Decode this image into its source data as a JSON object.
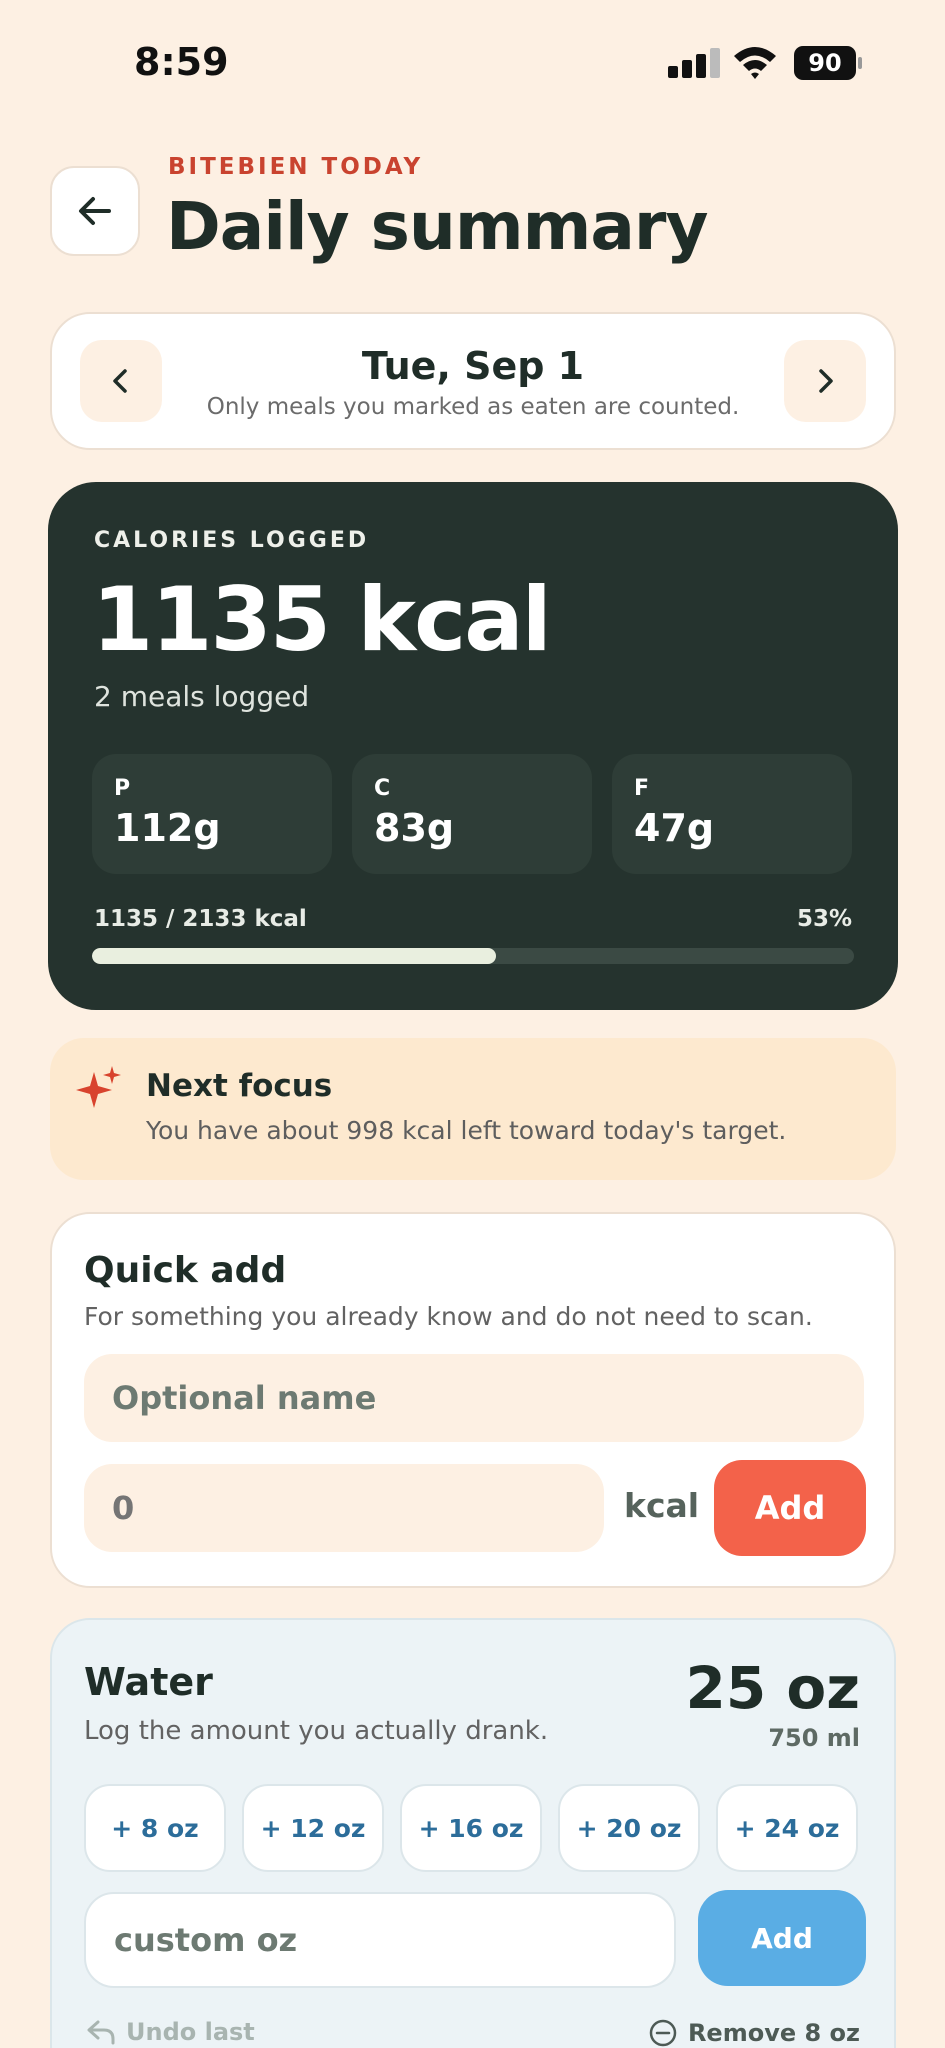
{
  "status_bar": {
    "time": "8:59",
    "battery": "90"
  },
  "header": {
    "eyebrow": "BITEBIEN TODAY",
    "title": "Daily summary"
  },
  "date_card": {
    "date": "Tue, Sep 1",
    "subtitle": "Only meals you marked as eaten are counted."
  },
  "calories": {
    "eyebrow": "CALORIES LOGGED",
    "value": "1135 kcal",
    "meals": "2 meals logged",
    "macros": [
      {
        "label": "P",
        "value": "112g"
      },
      {
        "label": "C",
        "value": "83g"
      },
      {
        "label": "F",
        "value": "47g"
      }
    ],
    "progress_text": "1135 / 2133 kcal",
    "progress_pct": "53%",
    "progress_fraction": 0.53
  },
  "focus": {
    "title": "Next focus",
    "text": "You have about 998 kcal left toward today's target."
  },
  "quick_add": {
    "title": "Quick add",
    "subtitle": "For something you already know and do not need to scan.",
    "name_placeholder": "Optional name",
    "kcal_placeholder": "0",
    "unit": "kcal",
    "button": "Add"
  },
  "water": {
    "title": "Water",
    "subtitle": "Log the amount you actually drank.",
    "total": "25 oz",
    "total_ml": "750 ml",
    "presets": [
      "+ 8 oz",
      "+ 12 oz",
      "+ 16 oz",
      "+ 20 oz",
      "+ 24 oz"
    ],
    "custom_placeholder": "custom oz",
    "button": "Add",
    "undo": "Undo last",
    "remove": "Remove 8 oz"
  },
  "colors": {
    "accent": "#f3624a",
    "dark_card": "#25332e",
    "water_button": "#5aade4",
    "eyebrow": "#c9432f"
  }
}
